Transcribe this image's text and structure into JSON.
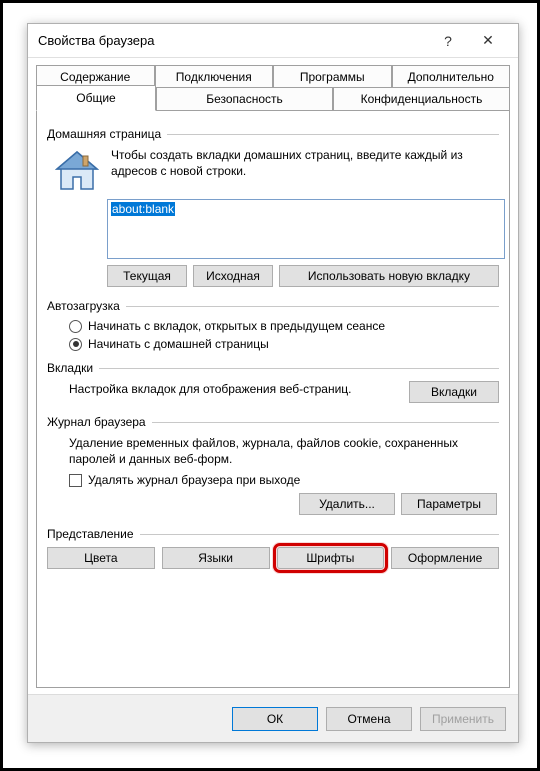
{
  "window": {
    "title": "Свойства браузера"
  },
  "tabs_row1": [
    "Содержание",
    "Подключения",
    "Программы",
    "Дополнительно"
  ],
  "tabs_row2": [
    "Общие",
    "Безопасность",
    "Конфиденциальность"
  ],
  "active_tab": "Общие",
  "home": {
    "group": "Домашняя страница",
    "desc": "Чтобы создать вкладки домашних страниц, введите каждый из адресов с новой строки.",
    "value": "about:blank",
    "btn_current": "Текущая",
    "btn_default": "Исходная",
    "btn_newtab": "Использовать новую вкладку"
  },
  "startup": {
    "group": "Автозагрузка",
    "opt_last": "Начинать с вкладок, открытых в предыдущем сеансе",
    "opt_home": "Начинать с домашней страницы",
    "selected": "opt_home"
  },
  "tabs_section": {
    "group": "Вкладки",
    "desc": "Настройка вкладок для отображения веб-страниц.",
    "btn": "Вкладки"
  },
  "history": {
    "group": "Журнал браузера",
    "desc": "Удаление временных файлов, журнала, файлов cookie, сохраненных паролей и данных веб-форм.",
    "check_label": "Удалять журнал браузера при выходе",
    "checked": false,
    "btn_delete": "Удалить...",
    "btn_settings": "Параметры"
  },
  "appearance": {
    "group": "Представление",
    "btn_colors": "Цвета",
    "btn_langs": "Языки",
    "btn_fonts": "Шрифты",
    "btn_access": "Оформление"
  },
  "footer": {
    "ok": "ОК",
    "cancel": "Отмена",
    "apply": "Применить"
  }
}
